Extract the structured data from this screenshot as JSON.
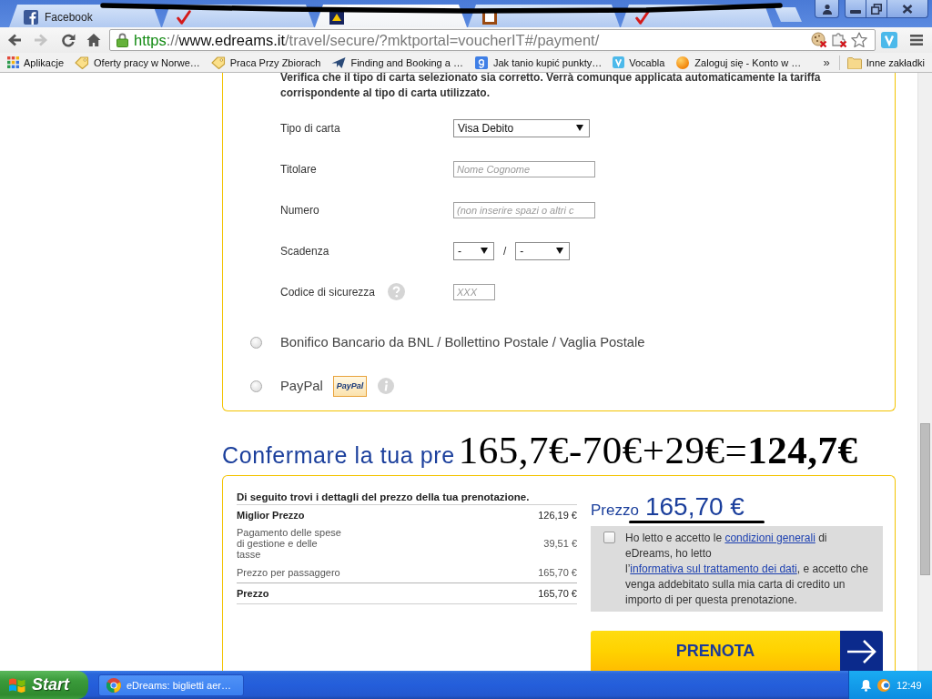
{
  "browser": {
    "tabs": [
      {
        "label": "Facebook",
        "kind": "f",
        "selected": false
      },
      {
        "kind": "tick",
        "selected": false
      },
      {
        "kind": "square",
        "selected": true
      },
      {
        "kind": "frame",
        "selected": false
      },
      {
        "kind": "tick",
        "selected": false
      }
    ],
    "navigation": {
      "back_disabled": false,
      "forward_disabled": true
    },
    "address": [
      {
        "text": "https",
        "kind": "scheme"
      },
      {
        "text": "://",
        "kind": "sep"
      },
      {
        "text": "www.edreams.it",
        "kind": "host"
      },
      {
        "text": "/travel/secure/?mktportal=voucherIT#/payment/",
        "kind": "path"
      }
    ],
    "bookmarks": [
      {
        "label": "Aplikacje",
        "kind": "grid"
      },
      {
        "label": "Oferty pracy w Norwe…",
        "kind": "tag"
      },
      {
        "label": "Praca Przy Zbiorach",
        "kind": "tag"
      },
      {
        "label": "Finding and Booking a …",
        "kind": "plane"
      },
      {
        "label": "Jak tanio kupić punkty…",
        "kind": "g"
      },
      {
        "label": "Vocabla",
        "kind": "v"
      },
      {
        "label": "Zaloguj się - Konto w …",
        "kind": "ball"
      }
    ],
    "bookmarks_overflow": "»",
    "other_bookmarks": "Inne zakładki"
  },
  "payment_form": {
    "notice": "Verifica che il tipo di carta selezionato sia corretto. Verrà comunque applicata automaticamente la tariffa corrispondente al tipo di carta utilizzato.",
    "fields": [
      {
        "label": "Tipo di carta",
        "kind": "select",
        "value": "Visa Debito"
      },
      {
        "label": "Titolare",
        "kind": "input",
        "placeholder": "Nome Cognome"
      },
      {
        "label": "Numero",
        "kind": "input",
        "placeholder": "(non inserire spazi o altri c"
      },
      {
        "label": "Scadenza",
        "kind": "expiry",
        "month": "-",
        "separator": "/",
        "year": "-"
      },
      {
        "label": "Codice di sicurezza",
        "kind": "code",
        "placeholder": "XXX",
        "help": true
      }
    ],
    "methods": [
      {
        "label": "Bonifico Bancario da BNL / Bollettino Postale / Vaglia Postale",
        "selected": false
      },
      {
        "label": "PayPal",
        "selected": false,
        "logo": "PayPal",
        "info": true
      }
    ]
  },
  "confirmation": {
    "heading": "Confermare la tua pre",
    "annotation": "165,7€-70€+29€=**124,7€**",
    "intro": "Di seguito trovi i dettagli del prezzo della tua prenotazione.",
    "rows": [
      {
        "label": "Miglior Prezzo",
        "value": "126,19 €",
        "kind": "bold"
      },
      {
        "label": "Pagamento delle spese di gestione e delle tasse",
        "value": "39,51 €",
        "kind": "plain"
      },
      {
        "label": "Prezzo per passaggero",
        "value": "165,70 €",
        "kind": "plain"
      },
      {
        "label": "Prezzo",
        "value": "165,70 €",
        "kind": "total"
      }
    ],
    "price_label": "Prezzo",
    "price": "165,70 €",
    "price_struck": true,
    "terms": {
      "checked": false,
      "parts": [
        {
          "kind": "text",
          "text": "Ho letto e accetto le "
        },
        {
          "kind": "link",
          "text": "condizioni generali"
        },
        {
          "kind": "text",
          "text": " di eDreams, ho letto l’"
        },
        {
          "kind": "link",
          "text": "informativa sul trattamento dei dati"
        },
        {
          "kind": "text",
          "text": ", e accetto che venga addebitato sulla mia carta di credito un importo di per questa prenotazione."
        }
      ]
    },
    "submit": "PRENOTA"
  },
  "taskbar": {
    "start": "Start",
    "tasks": [
      {
        "label": "eDreams: biglietti aer…",
        "selected": false
      }
    ],
    "clock": "12:49"
  }
}
